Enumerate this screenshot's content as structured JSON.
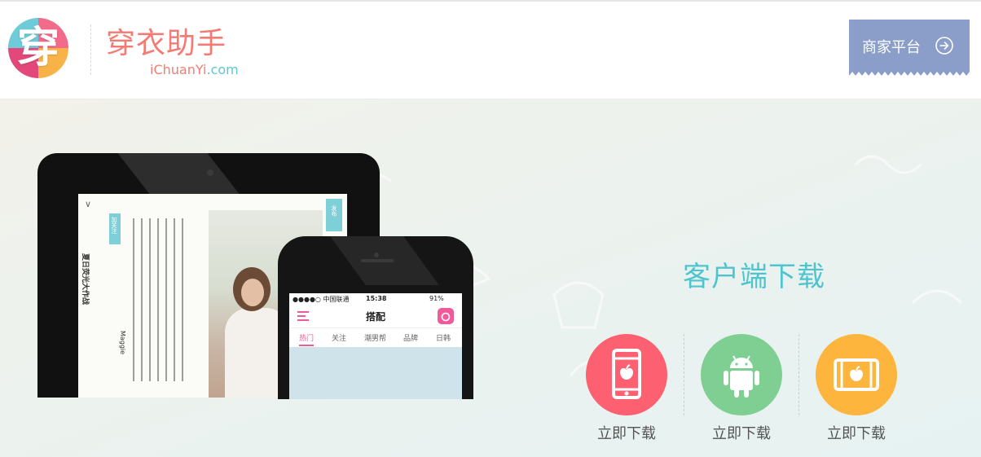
{
  "header": {
    "logo_char": "穿",
    "brand_cn": "穿衣助手",
    "brand_en_main": "iChuanYi",
    "brand_en_suffix": ".com",
    "merchant_button": "商家平台"
  },
  "hero": {
    "download_title": "客户端下载",
    "download_items": [
      {
        "label": "立即下载",
        "icon": "iphone-icon",
        "color": "#fd6070"
      },
      {
        "label": "立即下载",
        "icon": "android-icon",
        "color": "#7fcf93"
      },
      {
        "label": "立即下载",
        "icon": "ipad-icon",
        "color": "#fdb53d"
      }
    ]
  },
  "tablet_screen": {
    "column_title": "夏日荧光大作战",
    "follow_label": "加关注",
    "publish_label": "发布",
    "user": "Maggie"
  },
  "phone_screen": {
    "carrier": "●●●●○ 中国联通",
    "time": "15:38",
    "battery": "91%",
    "title": "搭配",
    "tabs": [
      "热门",
      "关注",
      "潮男帮",
      "品牌",
      "日韩"
    ]
  },
  "colors": {
    "accent": "#4ec4cf",
    "brand": "#f37b73",
    "merchant_bg": "#8a9ec9"
  }
}
